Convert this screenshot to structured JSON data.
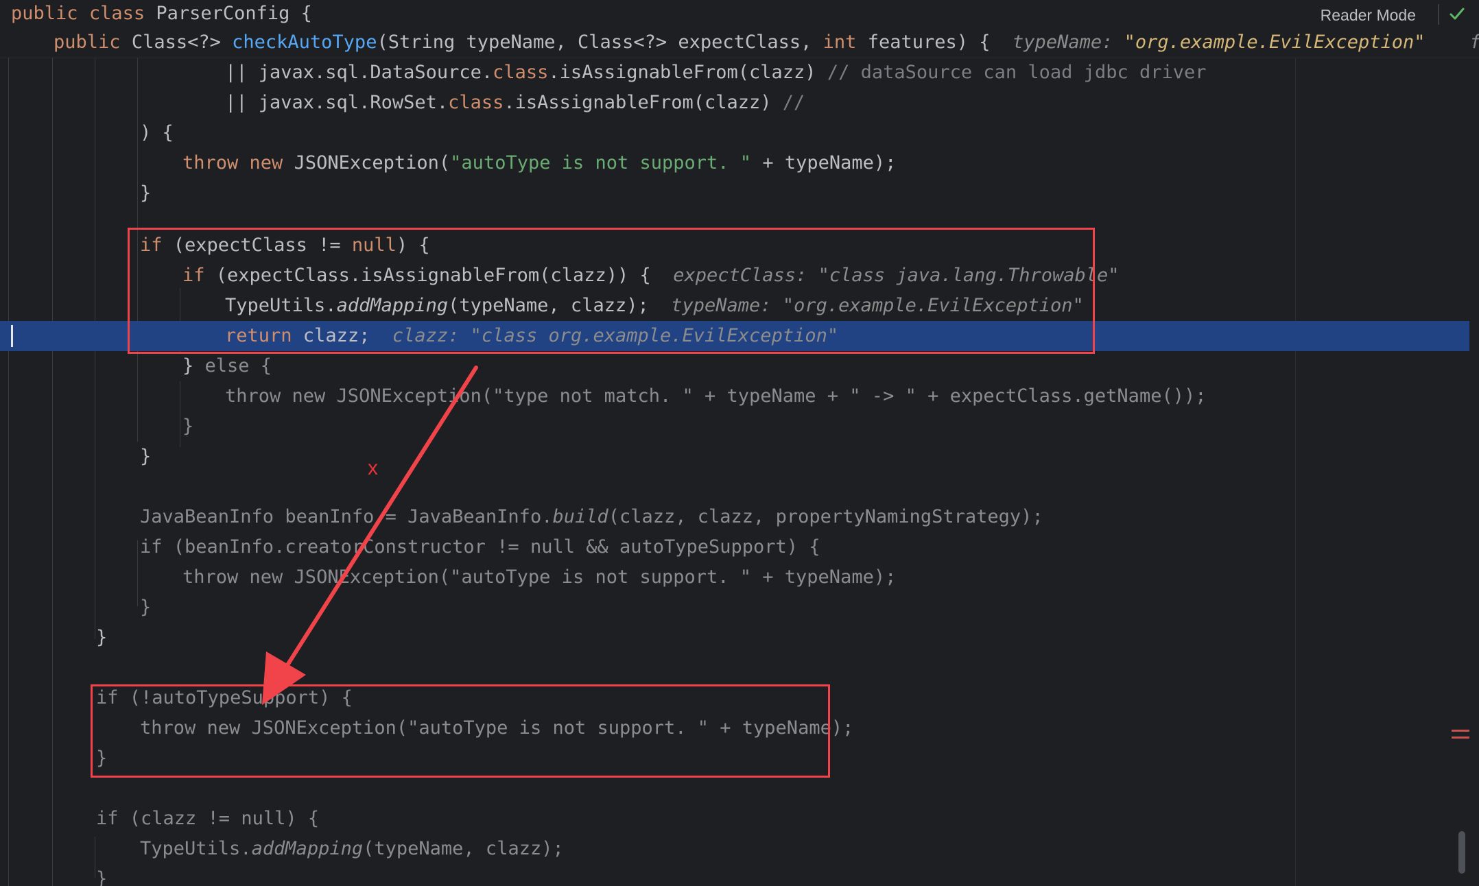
{
  "header": {
    "class_decl": [
      "public",
      "class",
      "ParserConfig {"
    ],
    "method_sig": {
      "mod": "public",
      "ret": "Class<?>",
      "name": "checkAutoType",
      "params_a": "(String typeName, Class<?> expectClass, ",
      "int_kw": "int",
      "params_b": " features) {",
      "hint_key": "typeName:",
      "hint_val": "\"org.example.EvilException\"",
      "hint_more": "featu"
    },
    "reader_mode": "Reader Mode",
    "status_icon": "check-icon"
  },
  "code": {
    "l1": {
      "a": "|| javax.sql.DataSource.",
      "kw": "class",
      "b": ".isAssignableFrom(clazz) ",
      "c": "// dataSource can load jdbc driver"
    },
    "l2": {
      "a": "|| javax.sql.RowSet.",
      "kw": "class",
      "b": ".isAssignableFrom(clazz) ",
      "c": "//"
    },
    "l3": ") {",
    "l4": {
      "kw1": "throw",
      "kw2": "new",
      "a": " JSONException(",
      "s": "\"autoType is not support. \"",
      "b": " + typeName);"
    },
    "l5": "}",
    "l6": {
      "kw": "if",
      "a": " (expectClass != ",
      "n": "null",
      "b": ") {"
    },
    "l7": {
      "kw": "if",
      "a": " (expectClass.isAssignableFrom(clazz)) {",
      "hk": "expectClass:",
      "hv": "\"class java.lang.Throwable\""
    },
    "l8": {
      "a": "TypeUtils.",
      "m": "addMapping",
      "b": "(typeName, clazz);",
      "hk": "typeName:",
      "hv": "\"org.example.EvilException\""
    },
    "l9": {
      "kw": "return",
      "a": " clazz;",
      "hk": "clazz:",
      "hv": "\"class org.example.EvilException\""
    },
    "l10": {
      "a": "} ",
      "b": "else {"
    },
    "l11": "throw new JSONException(\"type not match. \" + typeName + \" -> \" + expectClass.getName());",
    "l12": "}",
    "l13": "}",
    "l14": {
      "a": "JavaBeanInfo beanInfo = JavaBeanInfo.",
      "m": "build",
      "b": "(clazz, clazz, propertyNamingStrategy);"
    },
    "l15": "if (beanInfo.creatorConstructor != null && autoTypeSupport) {",
    "l16": "throw new JSONException(\"autoType is not support. \" + typeName);",
    "l17": "}",
    "l18": "}",
    "l19": "if (!autoTypeSupport) {",
    "l20": "throw new JSONException(\"autoType is not support. \" + typeName);",
    "l21": "}",
    "l22": "if (clazz != null) {",
    "l23": {
      "a": "TypeUtils.",
      "m": "addMapping",
      "b": "(typeName, clazz);"
    },
    "l24": "}"
  },
  "annotation": {
    "label": "x",
    "color": "#e8333b"
  },
  "colors": {
    "background": "#1e1f22",
    "keyword": "#cf8e6d",
    "string": "#6aab73",
    "method": "#56a8f5",
    "debug_line": "#214283",
    "annotation": "#f0434a"
  }
}
